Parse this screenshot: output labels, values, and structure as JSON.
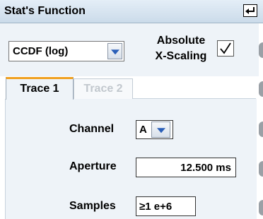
{
  "window": {
    "title": "Stat's Function"
  },
  "function_select": {
    "value": "CCDF (log)"
  },
  "absolute_scaling": {
    "label_line1": "Absolute",
    "label_line2": "X-Scaling",
    "checked": true
  },
  "tabs": [
    {
      "label": "Trace 1",
      "active": true
    },
    {
      "label": "Trace 2",
      "active": false
    }
  ],
  "channel": {
    "label": "Channel",
    "value": "A"
  },
  "aperture": {
    "label": "Aperture",
    "value": "12.500 ms"
  },
  "samples": {
    "label": "Samples",
    "value": "≥1 e+6"
  },
  "colors": {
    "tab_accent": "#f0a020",
    "dropdown_arrow": "#2a5fb8",
    "panel_bg": "#eef3f8"
  }
}
